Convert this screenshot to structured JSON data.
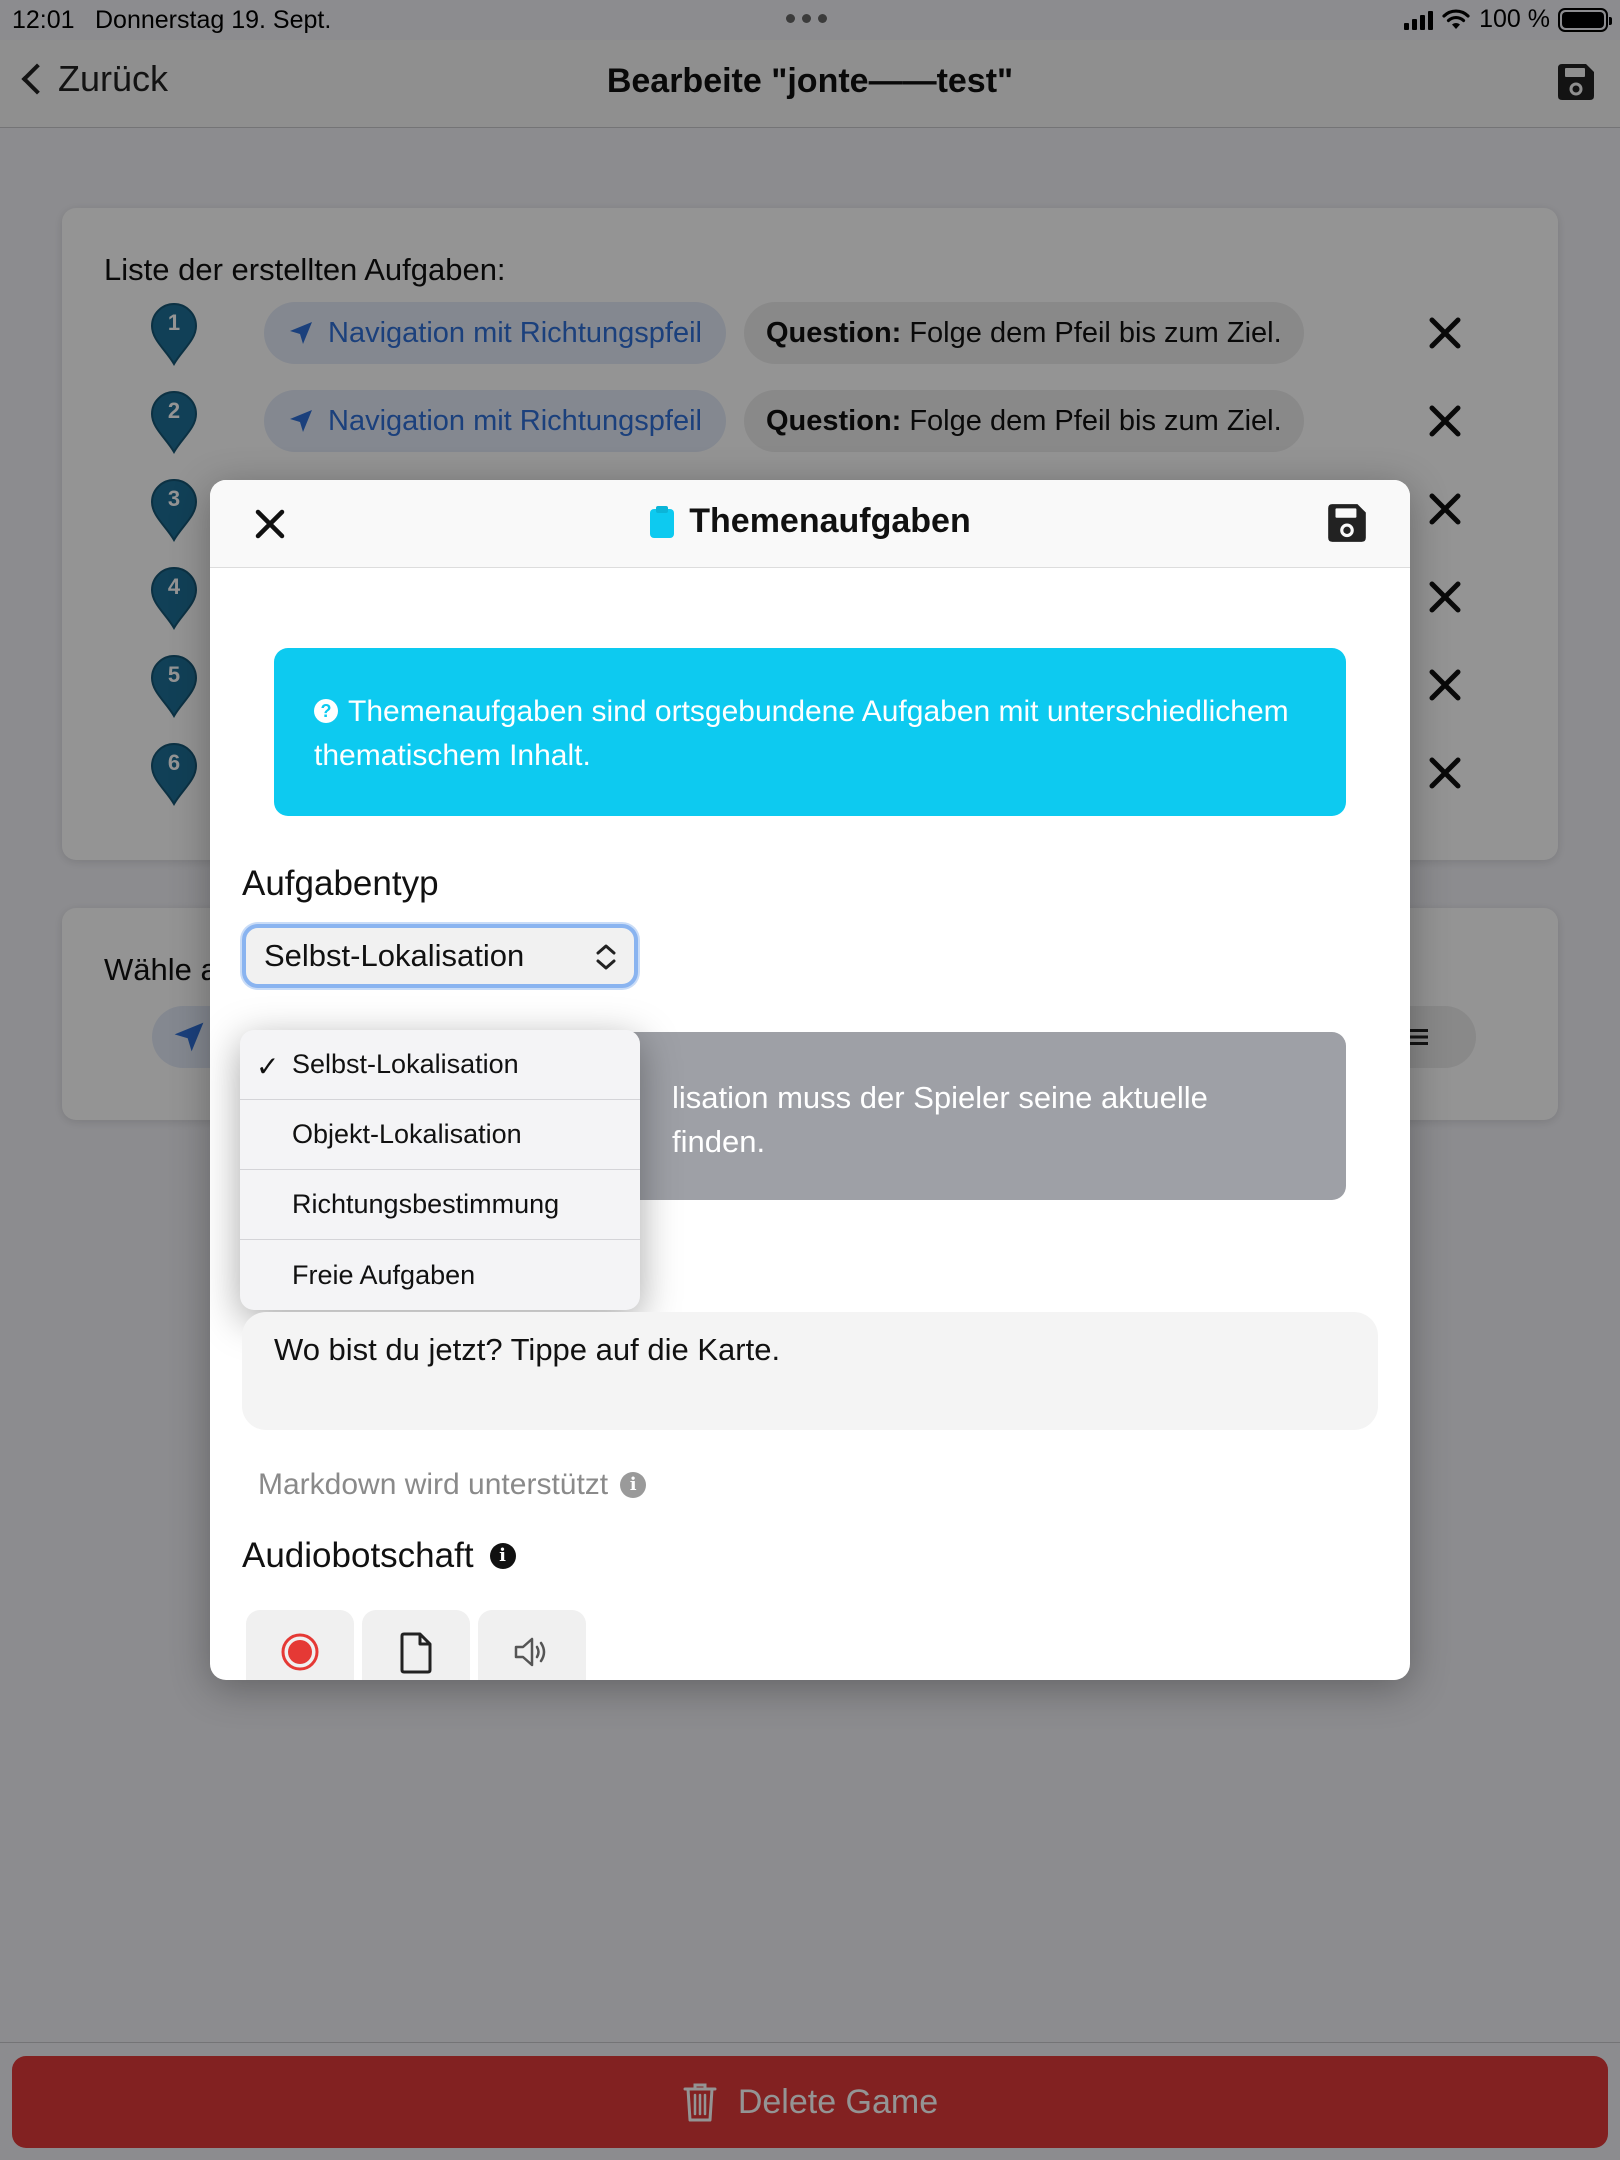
{
  "status_bar": {
    "time": "12:01",
    "date": "Donnerstag 19. Sept.",
    "battery": "100 %",
    "icons": [
      "signal-icon",
      "wifi-icon",
      "battery-icon"
    ]
  },
  "nav": {
    "back_label": "Zurück",
    "title": "Bearbeite \"jonte——test\"",
    "save_icon": "floppy-disk-icon"
  },
  "task_list": {
    "heading": "Liste der erstellten Aufgaben:",
    "tasks": [
      {
        "number": "1",
        "type": "Navigation mit Richtungspfeil",
        "question_label": "Question:",
        "question": "Folge dem Pfeil bis zum Ziel."
      },
      {
        "number": "2",
        "type": "Navigation mit Richtungspfeil",
        "question_label": "Question:",
        "question": "Folge dem Pfeil bis zum Ziel."
      },
      {
        "number": "3"
      },
      {
        "number": "4"
      },
      {
        "number": "5"
      },
      {
        "number": "6"
      }
    ]
  },
  "choose_section": {
    "heading": "Wähle a"
  },
  "delete_button": {
    "label": "Delete Game",
    "color": "#e03a3a"
  },
  "modal": {
    "title": "Themenaufgaben",
    "title_icon": "clipboard-icon",
    "info_text": "Themenaufgaben sind ortsgebundene Aufgaben mit unterschiedlichem thematischem Inhalt.",
    "info_color": "#0dcaf0",
    "task_type_label": "Aufgabentyp",
    "task_type_selected": "Selbst-Lokalisation",
    "task_type_options": [
      "Selbst-Lokalisation",
      "Objekt-Lokalisation",
      "Richtungsbestimmung",
      "Freie Aufgaben"
    ],
    "description_line1": "lisation muss der Spieler seine aktuelle",
    "description_line2": "finden.",
    "question_text": "Wo bist du jetzt? Tippe auf die Karte.",
    "markdown_hint": "Markdown wird unterstützt",
    "audio_label": "Audiobotschaft",
    "audio_buttons": [
      "record-icon",
      "file-icon",
      "speaker-icon"
    ]
  }
}
